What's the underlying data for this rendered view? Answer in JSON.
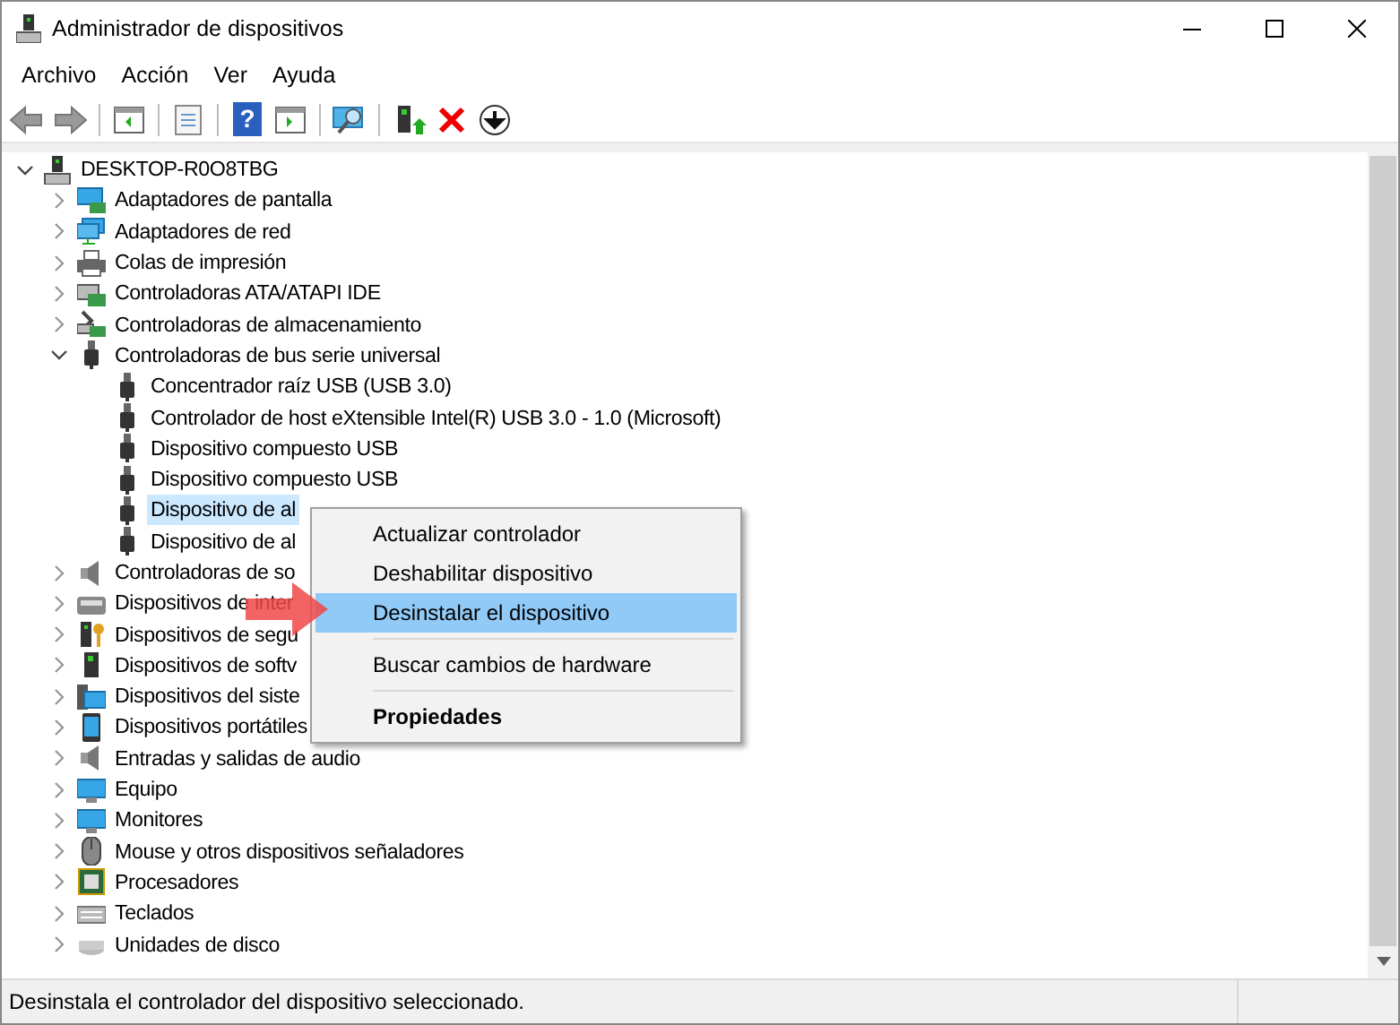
{
  "window": {
    "title": "Administrador de dispositivos"
  },
  "menu_bar": [
    "Archivo",
    "Acción",
    "Ver",
    "Ayuda"
  ],
  "toolbar_help": "?",
  "tree": {
    "label": "DESKTOP-R0O8TBG",
    "expanded": true,
    "selected": false,
    "children": [
      {
        "label": "Adaptadores de pantalla",
        "expanded": false,
        "selected": false
      },
      {
        "label": "Adaptadores de red",
        "expanded": false,
        "selected": false
      },
      {
        "label": "Colas de impresión",
        "expanded": false,
        "selected": false
      },
      {
        "label": "Controladoras ATA/ATAPI IDE",
        "expanded": false,
        "selected": false
      },
      {
        "label": "Controladoras de almacenamiento",
        "expanded": false,
        "selected": false
      },
      {
        "label": "Controladoras de bus serie universal",
        "expanded": true,
        "selected": false,
        "children": [
          {
            "label": "Concentrador raíz USB (USB 3.0)",
            "selected": false
          },
          {
            "label": "Controlador de host eXtensible Intel(R) USB 3.0 - 1.0 (Microsoft)",
            "selected": false
          },
          {
            "label": "Dispositivo compuesto USB",
            "selected": false
          },
          {
            "label": "Dispositivo compuesto USB",
            "selected": false
          },
          {
            "label": "Dispositivo de al",
            "selected": true
          },
          {
            "label": "Dispositivo de al",
            "selected": false
          }
        ]
      },
      {
        "label": "Controladoras de so",
        "expanded": false,
        "selected": false
      },
      {
        "label": "Dispositivos de inter",
        "expanded": false,
        "selected": false
      },
      {
        "label": "Dispositivos de segu",
        "expanded": false,
        "selected": false
      },
      {
        "label": "Dispositivos de softv",
        "expanded": false,
        "selected": false
      },
      {
        "label": "Dispositivos del siste",
        "expanded": false,
        "selected": false
      },
      {
        "label": "Dispositivos portátiles",
        "expanded": false,
        "selected": false
      },
      {
        "label": "Entradas y salidas de audio",
        "expanded": false,
        "selected": false
      },
      {
        "label": "Equipo",
        "expanded": false,
        "selected": false
      },
      {
        "label": "Monitores",
        "expanded": false,
        "selected": false
      },
      {
        "label": "Mouse y otros dispositivos señaladores",
        "expanded": false,
        "selected": false
      },
      {
        "label": "Procesadores",
        "expanded": false,
        "selected": false
      },
      {
        "label": "Teclados",
        "expanded": false,
        "selected": false
      },
      {
        "label": "Unidades de disco",
        "expanded": false,
        "selected": false
      }
    ]
  },
  "context_menu": [
    {
      "kind": "item",
      "label": "Actualizar controlador",
      "selected": false
    },
    {
      "kind": "item",
      "label": "Deshabilitar dispositivo",
      "selected": false
    },
    {
      "kind": "item",
      "label": "Desinstalar el dispositivo",
      "selected": true
    },
    {
      "kind": "separator"
    },
    {
      "kind": "item",
      "label": "Buscar cambios de hardware",
      "selected": false
    },
    {
      "kind": "separator"
    },
    {
      "kind": "default",
      "label": "Propiedades",
      "selected": false
    }
  ],
  "status_bar": "Desinstala el controlador del dispositivo seleccionado."
}
